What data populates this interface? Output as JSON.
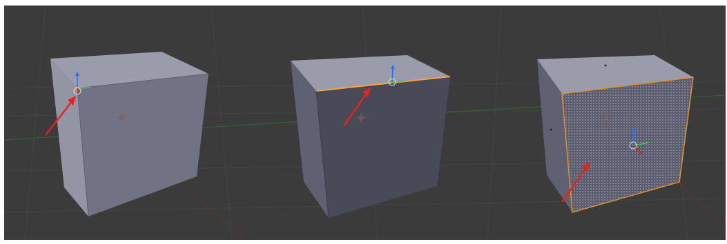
{
  "viewport": {
    "background": "#3b3b3b",
    "grid_color": "#444444",
    "x_axis_color": "#6f2e2e",
    "y_axis_color": "#2f6a2f"
  },
  "annotations": {
    "arrow_color": "#e8231c"
  },
  "gizmo": {
    "z_color": "#2a6cff",
    "y_color": "#3bd13b",
    "x_color": "#e02020",
    "cursor_icon": "3d-cursor-icon"
  },
  "panels": [
    {
      "name": "vertex-select",
      "selected_element": "vertex"
    },
    {
      "name": "edge-select",
      "selected_element": "edge"
    },
    {
      "name": "face-select",
      "selected_element": "face"
    }
  ]
}
